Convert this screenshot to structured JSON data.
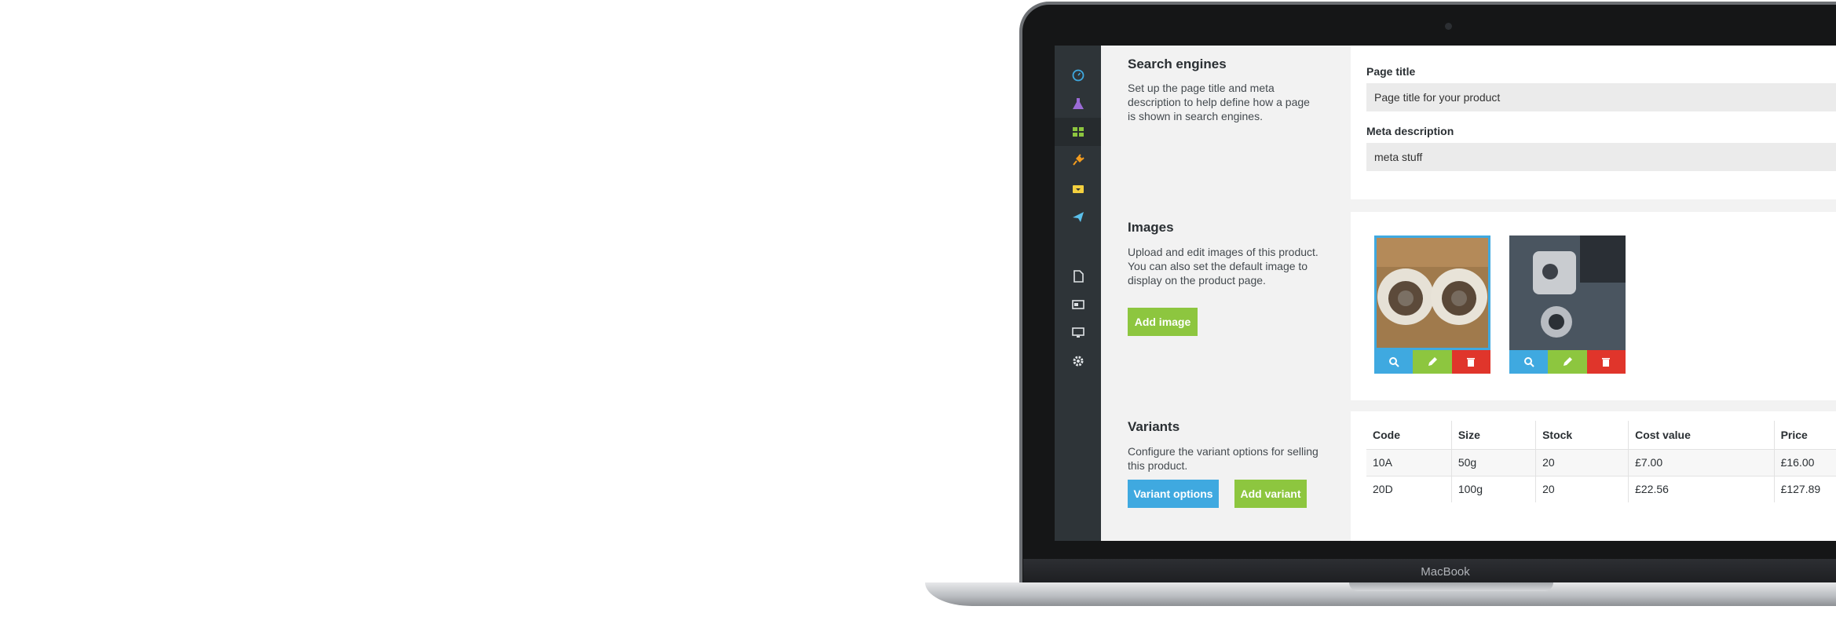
{
  "device": {
    "brand": "MacBook"
  },
  "sidebar": {
    "items": [
      {
        "icon": "dashboard-icon",
        "color": "#3fa9e0"
      },
      {
        "icon": "flask-icon",
        "color": "#9b6bd6"
      },
      {
        "icon": "grid-icon",
        "color": "#8dc63f",
        "active": true
      },
      {
        "icon": "plug-icon",
        "color": "#f39c1f"
      },
      {
        "icon": "inbox-icon",
        "color": "#f4d03f"
      },
      {
        "icon": "plane-icon",
        "color": "#5bc0eb"
      },
      {
        "icon": "page-icon",
        "color": "#dfe3e6"
      },
      {
        "icon": "card-icon",
        "color": "#dfe3e6"
      },
      {
        "icon": "monitor-icon",
        "color": "#dfe3e6"
      },
      {
        "icon": "gear-icon",
        "color": "#dfe3e6"
      }
    ]
  },
  "seo": {
    "title": "Search engines",
    "description": "Set up the page title and meta description to help define how a page is shown in search engines.",
    "page_title_label": "Page title",
    "page_title_value": "Page title for your product",
    "meta_label": "Meta description",
    "meta_value": "meta stuff"
  },
  "images": {
    "title": "Images",
    "description": "Upload and edit images of this product. You can also set the default image to display on the product page.",
    "add_label": "Add image"
  },
  "variants": {
    "title": "Variants",
    "description": "Configure the variant options for selling this product.",
    "options_label": "Variant options",
    "add_label": "Add variant",
    "columns": [
      "Code",
      "Size",
      "Stock",
      "Cost value",
      "Price"
    ],
    "rows": [
      [
        "10A",
        "50g",
        "20",
        "£7.00",
        "£16.00"
      ],
      [
        "20D",
        "100g",
        "20",
        "£22.56",
        "£127.89"
      ]
    ]
  },
  "colors": {
    "accent_blue": "#3fa9e0",
    "accent_green": "#8dc63f",
    "danger_red": "#e0352b"
  }
}
